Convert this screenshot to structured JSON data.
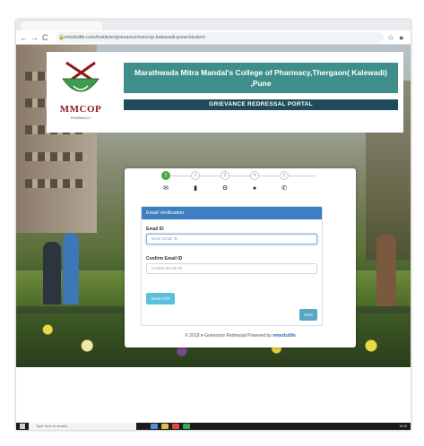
{
  "browser": {
    "nav_back": "←",
    "nav_forward": "→",
    "nav_reload": "C",
    "url": "vmedulife.com/institute/grievance/mmcop-kalewadi-pune/student",
    "star": "☆",
    "profile": "●"
  },
  "header": {
    "logo_text": "MMCOP",
    "logo_sub": "PHARMACY",
    "college_line1": "Marathwada Mitra Mandal's College of Pharmacy,Thergaon( Kalewadi)",
    "college_line2": ",Pune",
    "portal_title": "GRIEVANCE REDRESSAL PORTAL"
  },
  "steps": [
    {
      "number": "1",
      "icon": "envelope-icon",
      "glyph": "✉",
      "active": true
    },
    {
      "number": "2",
      "icon": "clipboard-icon",
      "glyph": "▮",
      "active": false
    },
    {
      "number": "3",
      "icon": "cogs-icon",
      "glyph": "⚙",
      "active": false
    },
    {
      "number": "4",
      "icon": "comment-icon",
      "glyph": "●",
      "active": false
    },
    {
      "number": "5",
      "icon": "phone-icon",
      "glyph": "✆",
      "active": false
    }
  ],
  "form": {
    "panel_title": "Email Verification",
    "email_label": "Email ID",
    "email_placeholder": "Enter Email ID",
    "confirm_label": "Confirm Email ID",
    "confirm_placeholder": "Confirm Email ID",
    "send_otp_label": "Send OTP",
    "next_label": "Next"
  },
  "footer": {
    "text": "© 2019 e-Grievance Redressal Powered by",
    "brand": "vmedulife"
  },
  "taskbar": {
    "search_placeholder": "Type here to search",
    "clock": "16:45"
  },
  "colors": {
    "title_bar": "#3e8f8b",
    "sub_bar": "#1f4c5a",
    "panel_head": "#3d7fc0",
    "step_active": "#49a84a",
    "btn_otp": "#5bc0de",
    "btn_next": "#5aa6c7"
  }
}
